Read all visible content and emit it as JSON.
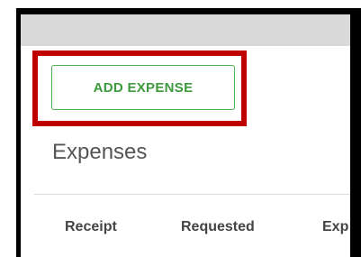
{
  "toolbar": {
    "add_expense_label": "ADD EXPENSE"
  },
  "main": {
    "title": "Expenses"
  },
  "table": {
    "columns": [
      "Receipt",
      "Requested",
      "Exp"
    ]
  },
  "colors": {
    "accent_green": "#4caf50",
    "highlight_red": "#c00000",
    "frame_black": "#000000",
    "topbar_gray": "#d9d9d9"
  }
}
